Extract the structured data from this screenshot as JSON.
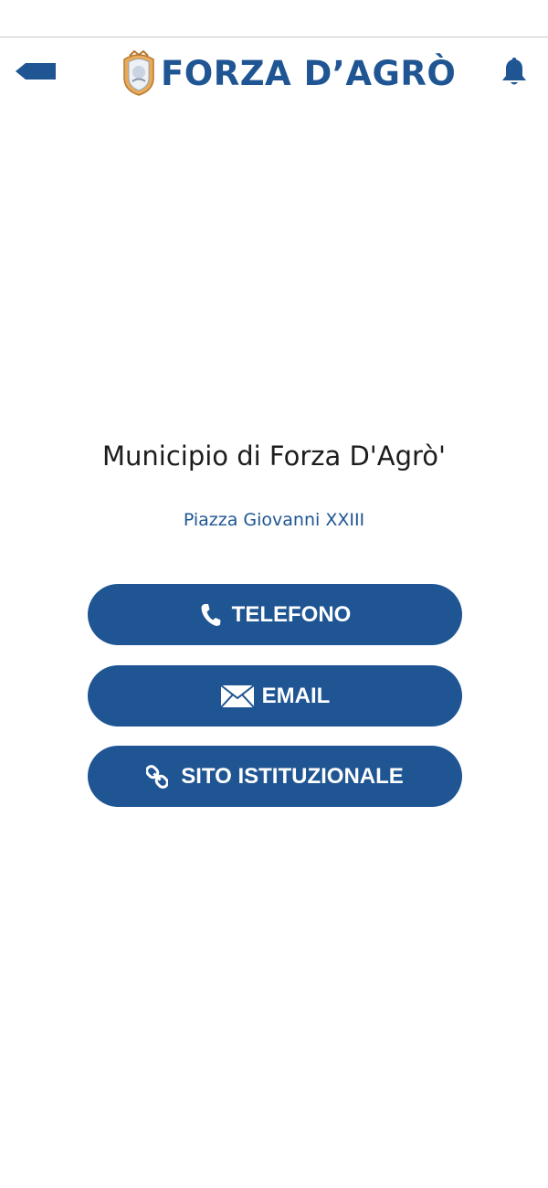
{
  "header": {
    "title": "FORZA D’AGRÒ",
    "back_icon": "back-arrow-icon",
    "notification_icon": "bell-icon",
    "brand_color": "#1f5593"
  },
  "place": {
    "name": "Municipio di Forza D'Agrò'",
    "address": "Piazza Giovanni XXIII"
  },
  "actions": [
    {
      "label": "TELEFONO",
      "icon": "phone-icon"
    },
    {
      "label": "EMAIL",
      "icon": "envelope-icon"
    },
    {
      "label": "SITO ISTITUZIONALE",
      "icon": "link-icon"
    }
  ]
}
